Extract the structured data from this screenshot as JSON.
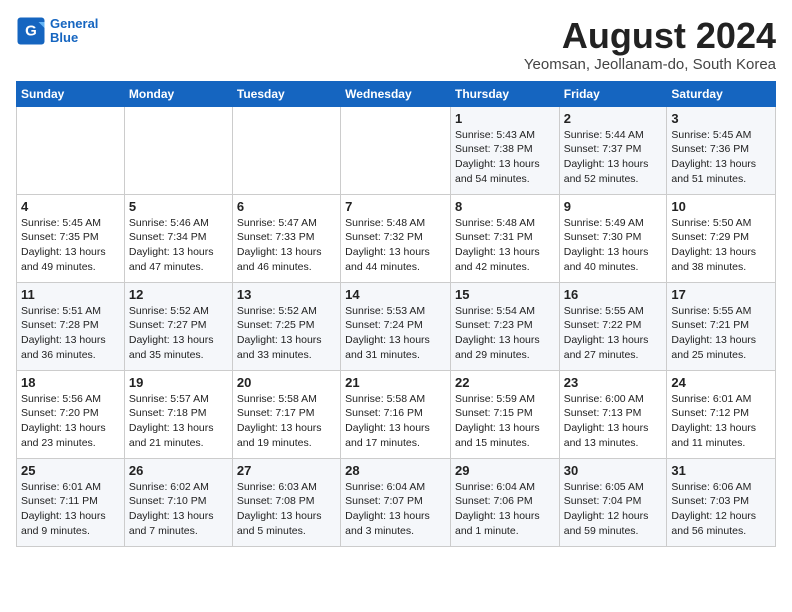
{
  "logo": {
    "line1": "General",
    "line2": "Blue"
  },
  "title": "August 2024",
  "location": "Yeomsan, Jeollanam-do, South Korea",
  "weekdays": [
    "Sunday",
    "Monday",
    "Tuesday",
    "Wednesday",
    "Thursday",
    "Friday",
    "Saturday"
  ],
  "weeks": [
    [
      {
        "day": "",
        "info": ""
      },
      {
        "day": "",
        "info": ""
      },
      {
        "day": "",
        "info": ""
      },
      {
        "day": "",
        "info": ""
      },
      {
        "day": "1",
        "info": "Sunrise: 5:43 AM\nSunset: 7:38 PM\nDaylight: 13 hours\nand 54 minutes."
      },
      {
        "day": "2",
        "info": "Sunrise: 5:44 AM\nSunset: 7:37 PM\nDaylight: 13 hours\nand 52 minutes."
      },
      {
        "day": "3",
        "info": "Sunrise: 5:45 AM\nSunset: 7:36 PM\nDaylight: 13 hours\nand 51 minutes."
      }
    ],
    [
      {
        "day": "4",
        "info": "Sunrise: 5:45 AM\nSunset: 7:35 PM\nDaylight: 13 hours\nand 49 minutes."
      },
      {
        "day": "5",
        "info": "Sunrise: 5:46 AM\nSunset: 7:34 PM\nDaylight: 13 hours\nand 47 minutes."
      },
      {
        "day": "6",
        "info": "Sunrise: 5:47 AM\nSunset: 7:33 PM\nDaylight: 13 hours\nand 46 minutes."
      },
      {
        "day": "7",
        "info": "Sunrise: 5:48 AM\nSunset: 7:32 PM\nDaylight: 13 hours\nand 44 minutes."
      },
      {
        "day": "8",
        "info": "Sunrise: 5:48 AM\nSunset: 7:31 PM\nDaylight: 13 hours\nand 42 minutes."
      },
      {
        "day": "9",
        "info": "Sunrise: 5:49 AM\nSunset: 7:30 PM\nDaylight: 13 hours\nand 40 minutes."
      },
      {
        "day": "10",
        "info": "Sunrise: 5:50 AM\nSunset: 7:29 PM\nDaylight: 13 hours\nand 38 minutes."
      }
    ],
    [
      {
        "day": "11",
        "info": "Sunrise: 5:51 AM\nSunset: 7:28 PM\nDaylight: 13 hours\nand 36 minutes."
      },
      {
        "day": "12",
        "info": "Sunrise: 5:52 AM\nSunset: 7:27 PM\nDaylight: 13 hours\nand 35 minutes."
      },
      {
        "day": "13",
        "info": "Sunrise: 5:52 AM\nSunset: 7:25 PM\nDaylight: 13 hours\nand 33 minutes."
      },
      {
        "day": "14",
        "info": "Sunrise: 5:53 AM\nSunset: 7:24 PM\nDaylight: 13 hours\nand 31 minutes."
      },
      {
        "day": "15",
        "info": "Sunrise: 5:54 AM\nSunset: 7:23 PM\nDaylight: 13 hours\nand 29 minutes."
      },
      {
        "day": "16",
        "info": "Sunrise: 5:55 AM\nSunset: 7:22 PM\nDaylight: 13 hours\nand 27 minutes."
      },
      {
        "day": "17",
        "info": "Sunrise: 5:55 AM\nSunset: 7:21 PM\nDaylight: 13 hours\nand 25 minutes."
      }
    ],
    [
      {
        "day": "18",
        "info": "Sunrise: 5:56 AM\nSunset: 7:20 PM\nDaylight: 13 hours\nand 23 minutes."
      },
      {
        "day": "19",
        "info": "Sunrise: 5:57 AM\nSunset: 7:18 PM\nDaylight: 13 hours\nand 21 minutes."
      },
      {
        "day": "20",
        "info": "Sunrise: 5:58 AM\nSunset: 7:17 PM\nDaylight: 13 hours\nand 19 minutes."
      },
      {
        "day": "21",
        "info": "Sunrise: 5:58 AM\nSunset: 7:16 PM\nDaylight: 13 hours\nand 17 minutes."
      },
      {
        "day": "22",
        "info": "Sunrise: 5:59 AM\nSunset: 7:15 PM\nDaylight: 13 hours\nand 15 minutes."
      },
      {
        "day": "23",
        "info": "Sunrise: 6:00 AM\nSunset: 7:13 PM\nDaylight: 13 hours\nand 13 minutes."
      },
      {
        "day": "24",
        "info": "Sunrise: 6:01 AM\nSunset: 7:12 PM\nDaylight: 13 hours\nand 11 minutes."
      }
    ],
    [
      {
        "day": "25",
        "info": "Sunrise: 6:01 AM\nSunset: 7:11 PM\nDaylight: 13 hours\nand 9 minutes."
      },
      {
        "day": "26",
        "info": "Sunrise: 6:02 AM\nSunset: 7:10 PM\nDaylight: 13 hours\nand 7 minutes."
      },
      {
        "day": "27",
        "info": "Sunrise: 6:03 AM\nSunset: 7:08 PM\nDaylight: 13 hours\nand 5 minutes."
      },
      {
        "day": "28",
        "info": "Sunrise: 6:04 AM\nSunset: 7:07 PM\nDaylight: 13 hours\nand 3 minutes."
      },
      {
        "day": "29",
        "info": "Sunrise: 6:04 AM\nSunset: 7:06 PM\nDaylight: 13 hours\nand 1 minute."
      },
      {
        "day": "30",
        "info": "Sunrise: 6:05 AM\nSunset: 7:04 PM\nDaylight: 12 hours\nand 59 minutes."
      },
      {
        "day": "31",
        "info": "Sunrise: 6:06 AM\nSunset: 7:03 PM\nDaylight: 12 hours\nand 56 minutes."
      }
    ]
  ]
}
